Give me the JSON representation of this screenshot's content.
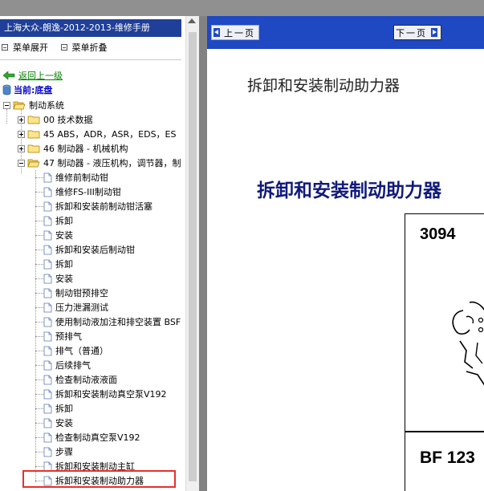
{
  "left_panel": {
    "title": "上海大众-朗逸-2012-2013-维修手册",
    "menu_expand": "菜单展开",
    "menu_collapse": "菜单折叠",
    "back_link": "返回上一级",
    "current": "当前:底盘",
    "tree": {
      "root": "制动系统",
      "folders": [
        "00 技术数据",
        "45 ABS，ADR，ASR，EDS，ES",
        "46 制动器 - 机械机构",
        "47 制动器 - 液压机构，调节器，制"
      ],
      "pages": [
        "维修前制动钳",
        "维修FS-III制动钳",
        "拆卸和安装前制动钳活塞",
        "拆卸",
        "安装",
        "拆卸和安装后制动钳",
        "拆卸",
        "安装",
        "制动钳预排空",
        "压力泄漏测试",
        "使用制动液加注和排空装置 BSF",
        "预排气",
        "排气（普通）",
        "后续排气",
        "检查制动液液面",
        "拆卸和安装制动真空泵V192",
        "拆卸",
        "安装",
        "检查制动真空泵V192",
        "步骤",
        "拆卸和安装制动主缸",
        "拆卸和安装制动助力器"
      ]
    }
  },
  "right_panel": {
    "prev_label": "上一页",
    "next_label": "下一页",
    "doc_title": "拆卸和安装制动助力器",
    "heading": "拆卸和安装制动助力器",
    "figure": {
      "tool_number": "3094",
      "part_label": "BF 123"
    }
  },
  "colors": {
    "title_bar": "#1f3f99",
    "nav_bar": "#1f49c2",
    "heading": "#101a7a",
    "link": "#008000",
    "highlight_box": "#e8302b"
  }
}
